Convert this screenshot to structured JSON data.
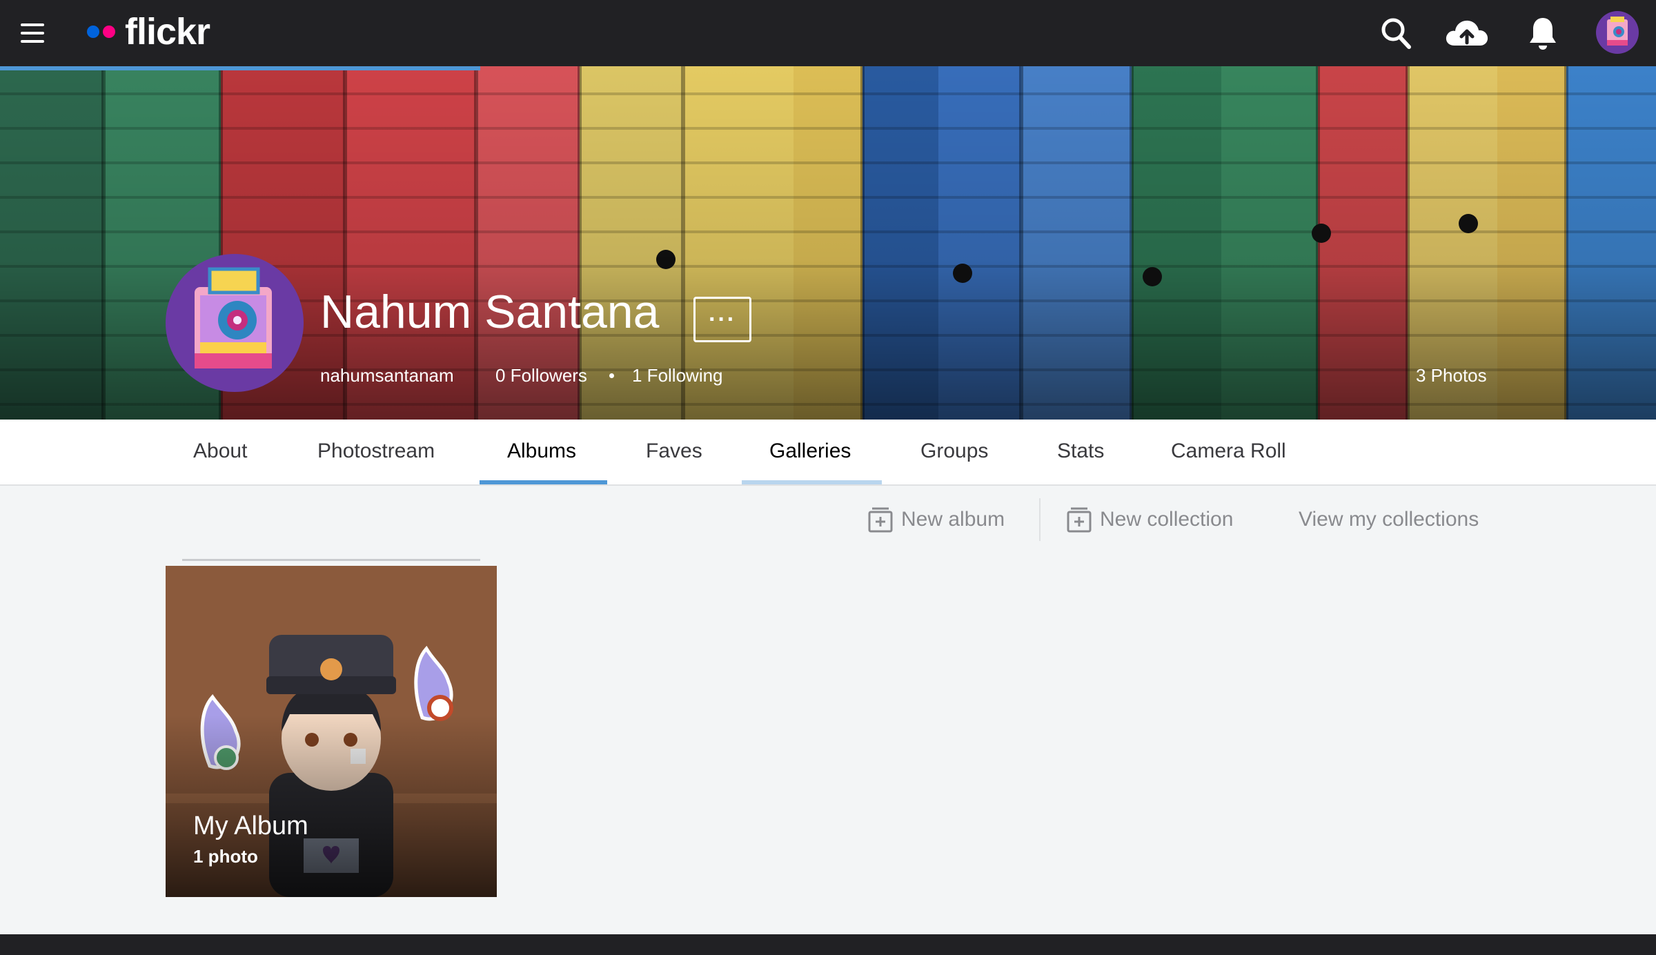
{
  "brand": {
    "name": "flickr"
  },
  "colors": {
    "topbar": "#212124",
    "accent_blue": "#0063dc",
    "accent_pink": "#ff0084",
    "active_tab": "#4e97d6"
  },
  "header_icons": [
    "menu-icon",
    "search-icon",
    "upload-cloud-icon",
    "notification-bell-icon",
    "user-avatar"
  ],
  "profile": {
    "name": "Nahum Santana",
    "username": "nahumsantanam",
    "followers": "0 Followers",
    "following": "1 Following",
    "photos": "3 Photos",
    "more_label": "···"
  },
  "tabs": [
    {
      "label": "About"
    },
    {
      "label": "Photostream"
    },
    {
      "label": "Albums",
      "active": true
    },
    {
      "label": "Faves"
    },
    {
      "label": "Galleries"
    },
    {
      "label": "Groups"
    },
    {
      "label": "Stats"
    },
    {
      "label": "Camera Roll"
    }
  ],
  "actions": {
    "new_album": "New album",
    "new_collection": "New collection",
    "view_collections": "View my collections"
  },
  "albums": [
    {
      "title": "My Album",
      "count": "1 photo"
    }
  ]
}
